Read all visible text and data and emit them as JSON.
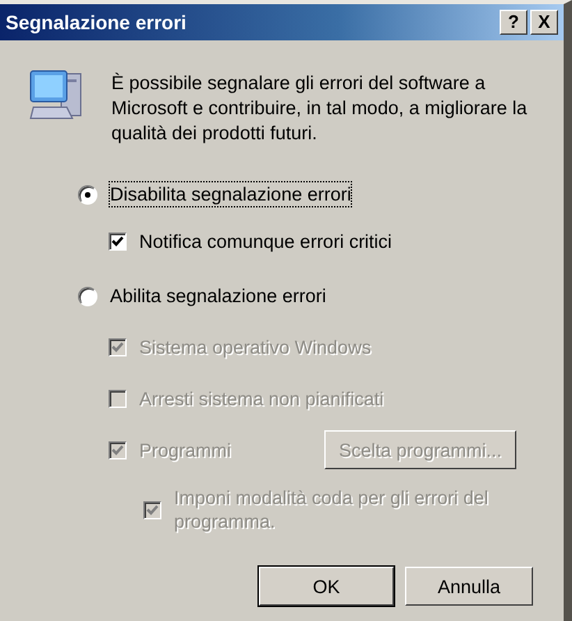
{
  "window": {
    "title": "Segnalazione errori",
    "title_buttons": [
      "?",
      "X"
    ]
  },
  "intro": "È possibile segnalare gli errori del software a Microsoft e contribuire, in tal modo, a migliorare la qualità dei prodotti futuri.",
  "options": [
    {
      "kind": "radio",
      "label": "Disabilita segnalazione errori",
      "selected": true,
      "focused": true,
      "disabled": false,
      "children": [
        {
          "kind": "checkbox",
          "label": "Notifica comunque errori critici",
          "checked": true,
          "disabled": false
        }
      ]
    },
    {
      "kind": "radio",
      "label": "Abilita segnalazione errori",
      "selected": false,
      "focused": false,
      "disabled": false,
      "children": [
        {
          "kind": "checkbox",
          "label": "Sistema operativo Windows",
          "checked": true,
          "disabled": true
        },
        {
          "kind": "checkbox",
          "label": "Arresti sistema non pianificati",
          "checked": false,
          "disabled": true
        },
        {
          "kind": "checkbox",
          "label": "Programmi",
          "checked": true,
          "disabled": true,
          "button": {
            "label": "Scelta programmi...",
            "disabled": true
          },
          "children": [
            {
              "kind": "checkbox",
              "label": "Imponi modalità coda per gli errori del programma.",
              "checked": true,
              "disabled": true
            }
          ]
        }
      ]
    }
  ],
  "buttons": [
    {
      "label": "OK",
      "default": true
    },
    {
      "label": "Annulla",
      "default": false
    }
  ]
}
